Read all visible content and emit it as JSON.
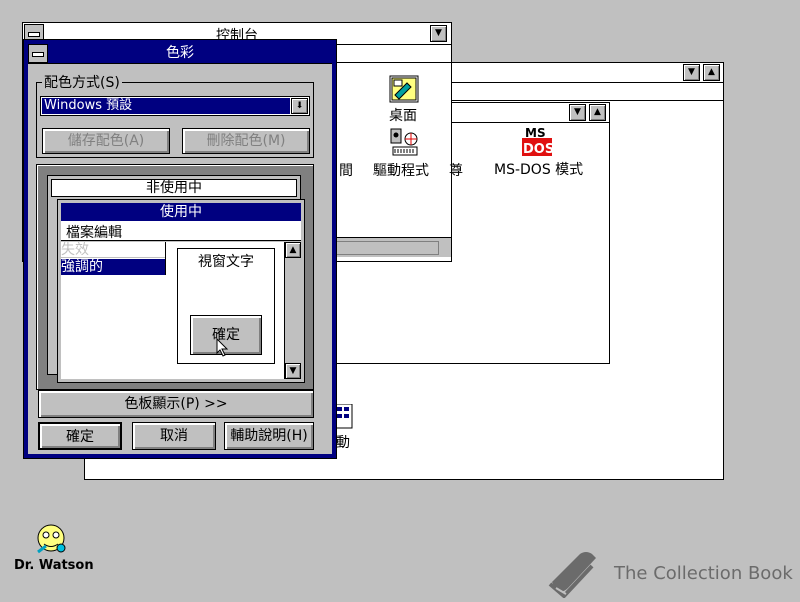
{
  "control_panel": {
    "title": "控制台"
  },
  "program_manager": {
    "icons": [
      {
        "name": "desktop",
        "label": "桌面"
      },
      {
        "name": "drivers",
        "label": "驅動程式"
      },
      {
        "name": "msdos",
        "label": "MS-DOS 模式"
      }
    ],
    "partial_labels": {
      "time_tail": "間",
      "calc_tail": "尊",
      "move_tail": "動"
    },
    "msdos_logo": {
      "top": "MS",
      "bottom": "DOS"
    }
  },
  "color_dialog": {
    "title": "色彩",
    "scheme_label": "配色方式(S)",
    "scheme_value": "Windows 預設",
    "save_scheme": "儲存配色(A)",
    "remove_scheme": "刪除配色(M)",
    "preview": {
      "inactive_title": "非使用中",
      "active_title": "使用中",
      "menu_item": "檔案編輯",
      "disabled_item": "失效",
      "highlighted_item": "強調的",
      "window_text": "視窗文字",
      "ok_button": "確定"
    },
    "palette_button": "色板顯示(P) >>",
    "ok": "確定",
    "cancel": "取消",
    "help": "輔助說明(H)"
  },
  "desktop": {
    "dr_watson_label": "Dr. Watson",
    "watermark": "The Collection Book"
  },
  "colors": {
    "desktop": "#c0c0c0",
    "active_title": "#000080",
    "window": "#ffffff",
    "face": "#c0c0c0",
    "shadow": "#808080"
  }
}
